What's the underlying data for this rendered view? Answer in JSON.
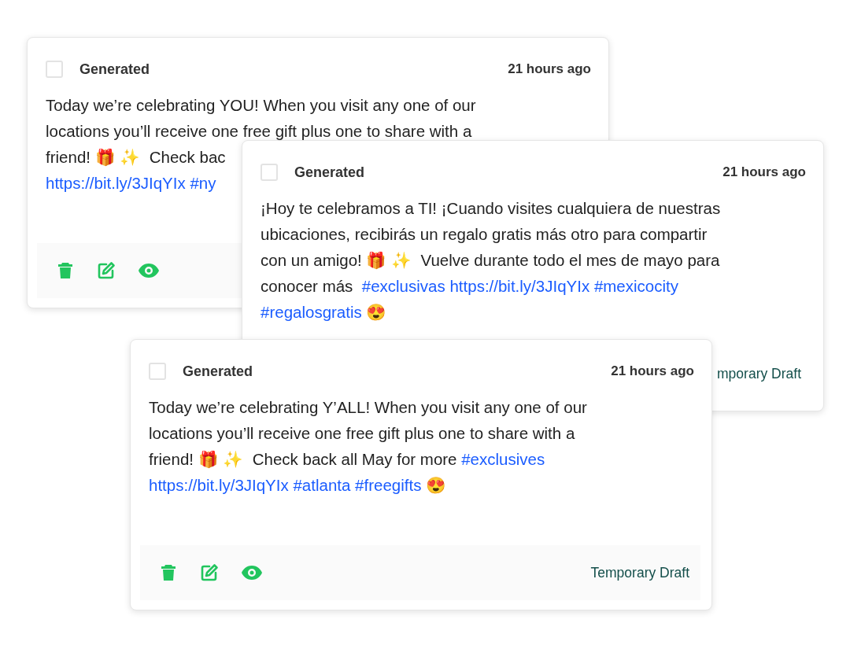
{
  "cards": [
    {
      "checked": false,
      "label": "Generated",
      "time": "21 hours ago",
      "lines": [
        [
          {
            "kind": "text",
            "text": "Today we’re celebrating YOU! When you visit any one of our"
          }
        ],
        [
          {
            "kind": "text",
            "text": "locations you’ll receive one free gift plus one to share with a"
          }
        ],
        [
          {
            "kind": "text",
            "text": "friend! 🎁 ✨  Check bac"
          }
        ],
        [
          {
            "kind": "link",
            "text": "https://bit.ly/3JIqYIx"
          },
          {
            "kind": "link",
            "text": "#ny"
          }
        ]
      ],
      "actions": [
        {
          "kind": "delete"
        },
        {
          "kind": "edit"
        },
        {
          "kind": "view"
        }
      ]
    },
    {
      "checked": false,
      "label": "Generated",
      "time": "21 hours ago",
      "lines": [
        [
          {
            "kind": "text",
            "text": "¡Hoy te celebramos a TI! ¡Cuando visites cualquiera de nuestras"
          }
        ],
        [
          {
            "kind": "text",
            "text": "ubicaciones, recibirás un regalo gratis más otro para compartir"
          }
        ],
        [
          {
            "kind": "text",
            "text": "con un amigo! 🎁 ✨  Vuelve durante todo el mes de mayo para"
          }
        ],
        [
          {
            "kind": "text",
            "text": "conocer más "
          },
          {
            "kind": "link",
            "text": "#exclusivas"
          },
          {
            "kind": "link",
            "text": "https://bit.ly/3JIqYIx"
          },
          {
            "kind": "link",
            "text": "#mexicocity"
          }
        ],
        [
          {
            "kind": "link",
            "text": "#regalosgratis"
          },
          {
            "kind": "text",
            "text": "😍"
          }
        ]
      ],
      "draft": "mporary Draft"
    },
    {
      "checked": false,
      "label": "Generated",
      "time": "21 hours ago",
      "lines": [
        [
          {
            "kind": "text",
            "text": "Today we’re celebrating Y’ALL! When you visit any one of our"
          }
        ],
        [
          {
            "kind": "text",
            "text": "locations you’ll receive one free gift plus one to share with a"
          }
        ],
        [
          {
            "kind": "text",
            "text": "friend! 🎁 ✨  Check back all May for more"
          },
          {
            "kind": "link",
            "text": "#exclusives"
          }
        ],
        [
          {
            "kind": "link",
            "text": "https://bit.ly/3JIqYIx"
          },
          {
            "kind": "link",
            "text": "#atlanta"
          },
          {
            "kind": "link",
            "text": "#freegifts"
          },
          {
            "kind": "text",
            "text": "😍"
          }
        ]
      ],
      "actions": [
        {
          "kind": "delete"
        },
        {
          "kind": "edit"
        },
        {
          "kind": "view"
        }
      ],
      "draft": "Temporary Draft"
    }
  ]
}
